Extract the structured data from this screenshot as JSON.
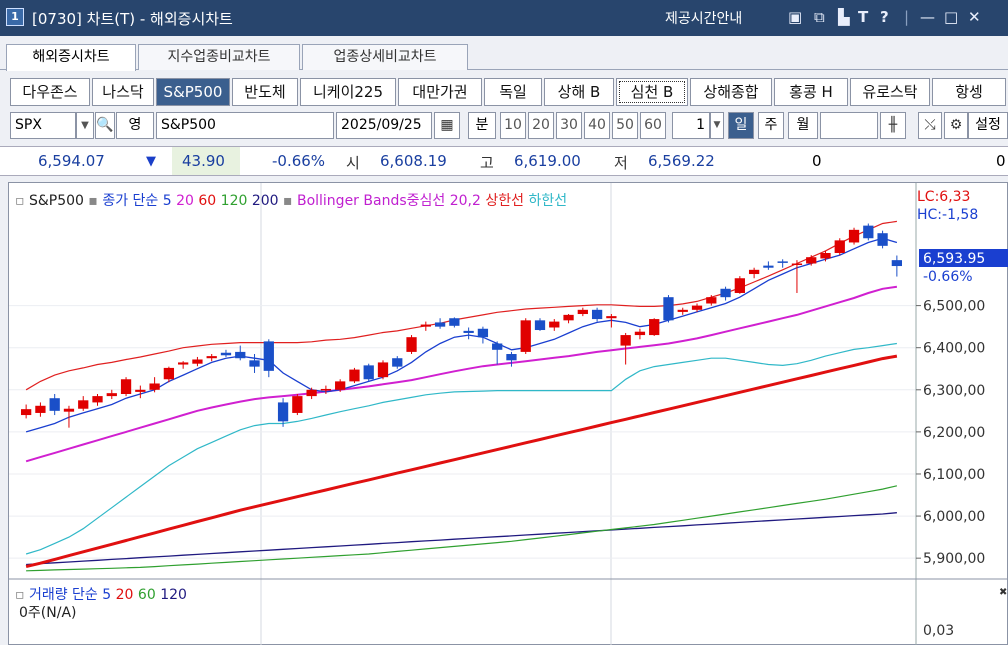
{
  "title": {
    "num": "1",
    "text": "[0730] 차트(T) - 해외증시차트",
    "provider": "제공시간안내"
  },
  "tabs": [
    "해외증시차트",
    "지수업종비교차트",
    "업종상세비교차트"
  ],
  "markets": [
    "다우존스",
    "나스닥",
    "S&P500",
    "반도체",
    "니케이225",
    "대만가권",
    "독일",
    "상해 B",
    "심천 B",
    "상해종합",
    "홍콩 H",
    "유로스탁",
    "항셍"
  ],
  "selected_market": "S&P500",
  "controls": {
    "symbol": "SPX",
    "search_label": "영",
    "name": "S&P500",
    "date": "2025/09/25",
    "period_label": "분",
    "minutes": [
      "10",
      "20",
      "30",
      "40",
      "50",
      "60"
    ],
    "count": "1",
    "daily": "일",
    "weekly": "주",
    "monthly": "월",
    "settings": "설정"
  },
  "quote": {
    "price": "6,594.07",
    "change": "43.90",
    "change_pct": "-0.66%",
    "open_label": "시",
    "open": "6,608.19",
    "high_label": "고",
    "high": "6,619.00",
    "low_label": "저",
    "low": "6,569.22",
    "volume": "0",
    "right_value": "0"
  },
  "legend": {
    "main": "S&P500",
    "ma_label": "종가 단순 5",
    "ma20": "20",
    "ma60": "60",
    "ma120": "120",
    "ma200": "200",
    "bb": "Bollinger Bands중심선 20,2",
    "bb_upper": "상한선",
    "bb_lower": "하한선",
    "lc": "LC:6,33",
    "hc": "HC:-1,58"
  },
  "axis": {
    "current_price": "6,593.95",
    "current_pct": "-0.66%",
    "ticks": [
      "6,500,00",
      "6,400,00",
      "6,300,00",
      "6,200,00",
      "6,100,00",
      "6,000,00",
      "5,900,00"
    ],
    "volume_tick": "0,03"
  },
  "volume_panel": {
    "label": "거래량",
    "ma_label": "단순 5",
    "ma20": "20",
    "ma60": "60",
    "ma120": "120",
    "value": "0주(N/A)"
  },
  "colors": {
    "up": "#e00000",
    "down": "#1a4fc8",
    "ma5": "#1a3fd0",
    "ma20": "#d020d0",
    "ma60": "#e01010",
    "ma120": "#30a030",
    "ma200": "#201a80",
    "bb_upper": "#e02020",
    "bb_lower": "#30b8c8"
  },
  "chart_data": {
    "type": "candlestick",
    "ylim": [
      5860,
      6720
    ],
    "candles": [
      {
        "o": 6240,
        "h": 6265,
        "l": 6232,
        "c": 6254
      },
      {
        "o": 6245,
        "h": 6270,
        "l": 6236,
        "c": 6262
      },
      {
        "o": 6280,
        "h": 6290,
        "l": 6240,
        "c": 6250
      },
      {
        "o": 6248,
        "h": 6262,
        "l": 6210,
        "c": 6255
      },
      {
        "o": 6255,
        "h": 6285,
        "l": 6250,
        "c": 6275
      },
      {
        "o": 6270,
        "h": 6290,
        "l": 6262,
        "c": 6285
      },
      {
        "o": 6285,
        "h": 6300,
        "l": 6278,
        "c": 6292
      },
      {
        "o": 6290,
        "h": 6330,
        "l": 6285,
        "c": 6325
      },
      {
        "o": 6295,
        "h": 6310,
        "l": 6280,
        "c": 6300
      },
      {
        "o": 6300,
        "h": 6330,
        "l": 6294,
        "c": 6315
      },
      {
        "o": 6325,
        "h": 6355,
        "l": 6318,
        "c": 6352
      },
      {
        "o": 6360,
        "h": 6368,
        "l": 6350,
        "c": 6365
      },
      {
        "o": 6362,
        "h": 6378,
        "l": 6356,
        "c": 6372
      },
      {
        "o": 6375,
        "h": 6385,
        "l": 6368,
        "c": 6380
      },
      {
        "o": 6388,
        "h": 6395,
        "l": 6378,
        "c": 6382
      },
      {
        "o": 6390,
        "h": 6405,
        "l": 6370,
        "c": 6375
      },
      {
        "o": 6370,
        "h": 6385,
        "l": 6340,
        "c": 6355
      },
      {
        "o": 6415,
        "h": 6420,
        "l": 6330,
        "c": 6345
      },
      {
        "o": 6270,
        "h": 6280,
        "l": 6212,
        "c": 6225
      },
      {
        "o": 6245,
        "h": 6290,
        "l": 6240,
        "c": 6285
      },
      {
        "o": 6285,
        "h": 6305,
        "l": 6278,
        "c": 6300
      },
      {
        "o": 6300,
        "h": 6310,
        "l": 6290,
        "c": 6302
      },
      {
        "o": 6300,
        "h": 6325,
        "l": 6295,
        "c": 6320
      },
      {
        "o": 6320,
        "h": 6352,
        "l": 6316,
        "c": 6348
      },
      {
        "o": 6358,
        "h": 6362,
        "l": 6320,
        "c": 6325
      },
      {
        "o": 6330,
        "h": 6370,
        "l": 6325,
        "c": 6365
      },
      {
        "o": 6375,
        "h": 6380,
        "l": 6350,
        "c": 6355
      },
      {
        "o": 6390,
        "h": 6430,
        "l": 6385,
        "c": 6425
      },
      {
        "o": 6450,
        "h": 6462,
        "l": 6440,
        "c": 6455
      },
      {
        "o": 6460,
        "h": 6470,
        "l": 6445,
        "c": 6450
      },
      {
        "o": 6470,
        "h": 6472,
        "l": 6448,
        "c": 6452
      },
      {
        "o": 6440,
        "h": 6448,
        "l": 6420,
        "c": 6435
      },
      {
        "o": 6445,
        "h": 6450,
        "l": 6410,
        "c": 6425
      },
      {
        "o": 6410,
        "h": 6415,
        "l": 6360,
        "c": 6395
      },
      {
        "o": 6385,
        "h": 6390,
        "l": 6355,
        "c": 6370
      },
      {
        "o": 6390,
        "h": 6470,
        "l": 6385,
        "c": 6465
      },
      {
        "o": 6465,
        "h": 6470,
        "l": 6440,
        "c": 6442
      },
      {
        "o": 6448,
        "h": 6468,
        "l": 6440,
        "c": 6462
      },
      {
        "o": 6465,
        "h": 6480,
        "l": 6458,
        "c": 6478
      },
      {
        "o": 6480,
        "h": 6495,
        "l": 6475,
        "c": 6490
      },
      {
        "o": 6490,
        "h": 6495,
        "l": 6462,
        "c": 6468
      },
      {
        "o": 6470,
        "h": 6480,
        "l": 6448,
        "c": 6475
      },
      {
        "o": 6405,
        "h": 6435,
        "l": 6360,
        "c": 6430
      },
      {
        "o": 6430,
        "h": 6445,
        "l": 6420,
        "c": 6438
      },
      {
        "o": 6430,
        "h": 6470,
        "l": 6428,
        "c": 6468
      },
      {
        "o": 6520,
        "h": 6525,
        "l": 6460,
        "c": 6465
      },
      {
        "o": 6485,
        "h": 6495,
        "l": 6478,
        "c": 6490
      },
      {
        "o": 6490,
        "h": 6505,
        "l": 6485,
        "c": 6500
      },
      {
        "o": 6505,
        "h": 6525,
        "l": 6500,
        "c": 6520
      },
      {
        "o": 6540,
        "h": 6545,
        "l": 6512,
        "c": 6520
      },
      {
        "o": 6530,
        "h": 6570,
        "l": 6528,
        "c": 6565
      },
      {
        "o": 6575,
        "h": 6590,
        "l": 6565,
        "c": 6585
      },
      {
        "o": 6595,
        "h": 6605,
        "l": 6585,
        "c": 6590
      },
      {
        "o": 6605,
        "h": 6610,
        "l": 6590,
        "c": 6602
      },
      {
        "o": 6598,
        "h": 6608,
        "l": 6530,
        "c": 6600
      },
      {
        "o": 6600,
        "h": 6620,
        "l": 6595,
        "c": 6615
      },
      {
        "o": 6612,
        "h": 6630,
        "l": 6605,
        "c": 6625
      },
      {
        "o": 6625,
        "h": 6660,
        "l": 6620,
        "c": 6655
      },
      {
        "o": 6650,
        "h": 6685,
        "l": 6645,
        "c": 6680
      },
      {
        "o": 6690,
        "h": 6695,
        "l": 6655,
        "c": 6660
      },
      {
        "o": 6672,
        "h": 6678,
        "l": 6636,
        "c": 6642
      },
      {
        "o": 6608,
        "h": 6619,
        "l": 6569,
        "c": 6594
      }
    ],
    "ma5": [
      6200,
      6210,
      6220,
      6235,
      6245,
      6255,
      6265,
      6280,
      6290,
      6300,
      6320,
      6335,
      6350,
      6365,
      6375,
      6380,
      6375,
      6370,
      6340,
      6320,
      6300,
      6295,
      6300,
      6310,
      6320,
      6330,
      6345,
      6365,
      6390,
      6410,
      6425,
      6430,
      6425,
      6410,
      6395,
      6400,
      6410,
      6420,
      6435,
      6450,
      6460,
      6465,
      6460,
      6450,
      6455,
      6465,
      6475,
      6485,
      6495,
      6505,
      6520,
      6540,
      6560,
      6575,
      6590,
      6600,
      6610,
      6620,
      6635,
      6650,
      6660,
      6650
    ],
    "bb_middle": [
      6130,
      6140,
      6150,
      6160,
      6170,
      6180,
      6190,
      6200,
      6210,
      6220,
      6230,
      6240,
      6250,
      6258,
      6265,
      6272,
      6278,
      6282,
      6285,
      6288,
      6292,
      6296,
      6300,
      6304,
      6308,
      6313,
      6318,
      6323,
      6330,
      6337,
      6344,
      6350,
      6356,
      6360,
      6364,
      6368,
      6372,
      6376,
      6380,
      6385,
      6390,
      6394,
      6398,
      6402,
      6406,
      6410,
      6416,
      6422,
      6430,
      6438,
      6446,
      6454,
      6462,
      6470,
      6478,
      6488,
      6498,
      6508,
      6518,
      6530,
      6540,
      6545
    ],
    "bb_upper": [
      6300,
      6320,
      6335,
      6345,
      6352,
      6360,
      6365,
      6372,
      6378,
      6385,
      6392,
      6400,
      6404,
      6408,
      6410,
      6412,
      6412,
      6412,
      6412,
      6412,
      6414,
      6418,
      6420,
      6424,
      6430,
      6436,
      6440,
      6446,
      6452,
      6458,
      6466,
      6472,
      6478,
      6484,
      6488,
      6492,
      6494,
      6496,
      6498,
      6500,
      6502,
      6502,
      6500,
      6498,
      6498,
      6500,
      6504,
      6510,
      6520,
      6530,
      6542,
      6556,
      6570,
      6585,
      6600,
      6615,
      6630,
      6648,
      6665,
      6680,
      6695,
      6700
    ],
    "bb_lower": [
      5910,
      5920,
      5935,
      5950,
      5970,
      5995,
      6020,
      6045,
      6070,
      6095,
      6120,
      6140,
      6160,
      6175,
      6190,
      6205,
      6215,
      6220,
      6220,
      6225,
      6232,
      6240,
      6248,
      6255,
      6262,
      6270,
      6276,
      6282,
      6288,
      6292,
      6295,
      6296,
      6297,
      6298,
      6298,
      6298,
      6298,
      6298,
      6298,
      6298,
      6298,
      6298,
      6325,
      6345,
      6355,
      6360,
      6365,
      6370,
      6375,
      6375,
      6370,
      6365,
      6360,
      6358,
      6362,
      6370,
      6380,
      6388,
      6396,
      6400,
      6405,
      6410
    ],
    "ma60": [
      5880,
      5888,
      5897,
      5906,
      5915,
      5924,
      5933,
      5942,
      5951,
      5960,
      5969,
      5978,
      5987,
      5996,
      6005,
      6014,
      6022,
      6030,
      6038,
      6046,
      6054,
      6062,
      6070,
      6078,
      6086,
      6094,
      6102,
      6110,
      6118,
      6126,
      6134,
      6142,
      6150,
      6158,
      6166,
      6174,
      6182,
      6190,
      6198,
      6206,
      6214,
      6222,
      6230,
      6238,
      6246,
      6254,
      6262,
      6270,
      6278,
      6286,
      6294,
      6302,
      6310,
      6318,
      6326,
      6334,
      6342,
      6350,
      6358,
      6366,
      6374,
      6380
    ],
    "ma120": [
      5870,
      5871,
      5872,
      5873,
      5874,
      5875,
      5876,
      5877,
      5878,
      5880,
      5882,
      5884,
      5886,
      5888,
      5890,
      5892,
      5894,
      5896,
      5898,
      5900,
      5902,
      5904,
      5906,
      5908,
      5910,
      5913,
      5916,
      5919,
      5922,
      5925,
      5928,
      5931,
      5934,
      5937,
      5940,
      5944,
      5948,
      5952,
      5956,
      5960,
      5964,
      5968,
      5972,
      5976,
      5980,
      5985,
      5990,
      5995,
      6000,
      6005,
      6010,
      6015,
      6020,
      6025,
      6030,
      6035,
      6040,
      6046,
      6052,
      6058,
      6064,
      6072
    ],
    "ma200": [
      5885,
      5887,
      5889,
      5891,
      5893,
      5895,
      5897,
      5899,
      5901,
      5903,
      5905,
      5907,
      5909,
      5911,
      5913,
      5915,
      5917,
      5919,
      5921,
      5923,
      5925,
      5927,
      5929,
      5931,
      5933,
      5935,
      5937,
      5939,
      5941,
      5943,
      5945,
      5947,
      5949,
      5951,
      5953,
      5955,
      5957,
      5959,
      5961,
      5963,
      5965,
      5967,
      5969,
      5971,
      5973,
      5975,
      5977,
      5979,
      5981,
      5983,
      5985,
      5987,
      5989,
      5991,
      5993,
      5995,
      5997,
      5999,
      6001,
      6003,
      6005,
      6008
    ]
  }
}
